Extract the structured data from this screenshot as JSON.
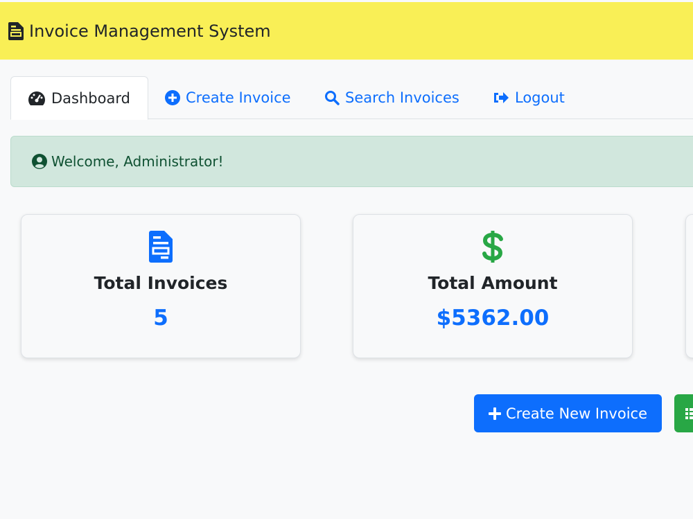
{
  "navbar": {
    "brand_icon": "file-invoice-icon",
    "title": "Invoice Management System",
    "background": "#f9ef56"
  },
  "tabs": [
    {
      "label": "Dashboard",
      "icon": "tachometer-icon",
      "active": true
    },
    {
      "label": "Create Invoice",
      "icon": "plus-circle-icon",
      "active": false
    },
    {
      "label": "Search Invoices",
      "icon": "search-icon",
      "active": false
    },
    {
      "label": "Logout",
      "icon": "sign-out-icon",
      "active": false
    }
  ],
  "alert": {
    "icon": "user-circle-icon",
    "message": "Welcome, Administrator!"
  },
  "stats": [
    {
      "title": "Total Invoices",
      "value": "5",
      "icon": "file-invoice-icon",
      "icon_color": "#0d6efd"
    },
    {
      "title": "Total Amount",
      "value": "$5362.00",
      "icon": "dollar-sign-icon",
      "icon_color": "#28a745"
    }
  ],
  "actions": {
    "create_label": "Create New Invoice",
    "create_icon": "plus-icon",
    "second_icon": "list-icon"
  },
  "colors": {
    "primary": "#0d6efd",
    "success": "#28a745",
    "alert_bg": "#d1e7dd",
    "alert_text": "#0f5132"
  }
}
